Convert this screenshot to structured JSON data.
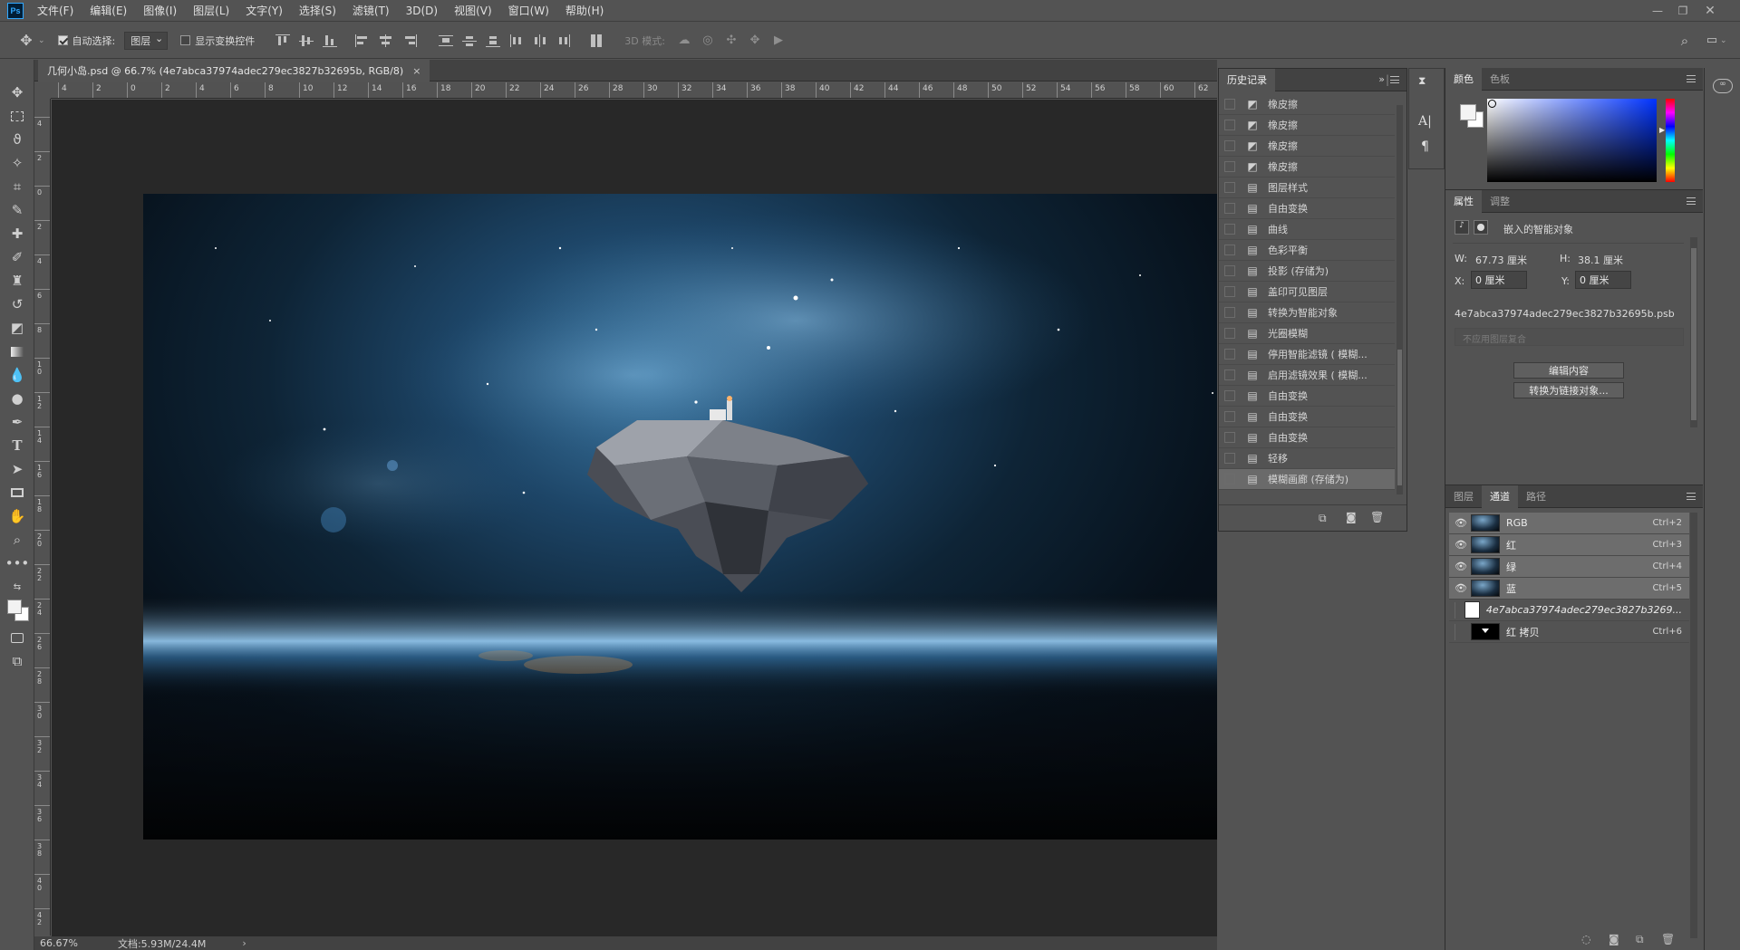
{
  "menu": {
    "items": [
      "文件(F)",
      "编辑(E)",
      "图像(I)",
      "图层(L)",
      "文字(Y)",
      "选择(S)",
      "滤镜(T)",
      "3D(D)",
      "视图(V)",
      "窗口(W)",
      "帮助(H)"
    ]
  },
  "options": {
    "auto_select_label": "自动选择:",
    "auto_select_value": "图层",
    "show_transform_label": "显示变换控件",
    "mode_3d_label": "3D 模式:"
  },
  "document": {
    "tab_title": "几何小岛.psd @ 66.7% (4e7abca37974adec279ec3827b32695b, RGB/8)",
    "close_glyph": "×",
    "zoom": "66.67%",
    "doc_size": "文档:5.93M/24.4M"
  },
  "rulers": {
    "h_labels": [
      "4",
      "2",
      "0",
      "2",
      "4",
      "6",
      "8",
      "10",
      "12",
      "14",
      "16",
      "18",
      "20",
      "22",
      "24",
      "26",
      "28",
      "30",
      "32",
      "34",
      "36",
      "38",
      "40",
      "42",
      "44",
      "46",
      "48",
      "50",
      "52",
      "54",
      "56",
      "58",
      "60",
      "62"
    ],
    "v_labels": [
      "4",
      "2",
      "0",
      "2",
      "4",
      "6",
      "8",
      "1 0",
      "1 2",
      "1 4",
      "1 6",
      "1 8",
      "2 0",
      "2 2",
      "2 4",
      "2 6",
      "2 8",
      "3 0",
      "3 2",
      "3 4",
      "3 6",
      "3 8",
      "4 0",
      "4 2"
    ]
  },
  "history": {
    "tab": "历史记录",
    "items": [
      {
        "label": "橡皮擦",
        "icon": "eraser"
      },
      {
        "label": "橡皮擦",
        "icon": "eraser"
      },
      {
        "label": "橡皮擦",
        "icon": "eraser"
      },
      {
        "label": "橡皮擦",
        "icon": "eraser"
      },
      {
        "label": "图层样式",
        "icon": "doc"
      },
      {
        "label": "自由变换",
        "icon": "doc"
      },
      {
        "label": "曲线",
        "icon": "doc"
      },
      {
        "label": "色彩平衡",
        "icon": "doc"
      },
      {
        "label": "投影 (存储为)",
        "icon": "doc"
      },
      {
        "label": "盖印可见图层",
        "icon": "doc"
      },
      {
        "label": "转换为智能对象",
        "icon": "doc"
      },
      {
        "label": "光圈模糊",
        "icon": "doc"
      },
      {
        "label": "停用智能滤镜 ( 模糊...",
        "icon": "doc"
      },
      {
        "label": "启用滤镜效果 ( 模糊...",
        "icon": "doc"
      },
      {
        "label": "自由变换",
        "icon": "doc"
      },
      {
        "label": "自由变换",
        "icon": "doc"
      },
      {
        "label": "自由变换",
        "icon": "doc"
      },
      {
        "label": "轻移",
        "icon": "doc"
      },
      {
        "label": "模糊画廊 (存储为)",
        "icon": "doc"
      }
    ],
    "selected_index": 18
  },
  "color_panel": {
    "tabs": [
      "颜色",
      "色板"
    ]
  },
  "properties": {
    "tabs": [
      "属性",
      "调整"
    ],
    "kind": "嵌入的智能对象",
    "w_label": "W:",
    "w_value": "67.73 厘米",
    "h_label": "H:",
    "h_value": "38.1 厘米",
    "x_label": "X:",
    "x_value": "0 厘米",
    "y_label": "Y:",
    "y_value": "0 厘米",
    "filename": "4e7abca37974adec279ec3827b32695b.psb",
    "comp_placeholder": "不应用图层复合",
    "edit_btn": "编辑内容",
    "link_btn": "转换为链接对象..."
  },
  "channels": {
    "tabs": [
      "图层",
      "通道",
      "路径"
    ],
    "rows": [
      {
        "name": "RGB",
        "key": "Ctrl+2",
        "visible": true,
        "selected": true,
        "thumb": "space"
      },
      {
        "name": "红",
        "key": "Ctrl+3",
        "visible": true,
        "selected": true,
        "thumb": "space"
      },
      {
        "name": "绿",
        "key": "Ctrl+4",
        "visible": true,
        "selected": true,
        "thumb": "space"
      },
      {
        "name": "蓝",
        "key": "Ctrl+5",
        "visible": true,
        "selected": true,
        "thumb": "space"
      },
      {
        "name": "4e7abca37974adec279ec3827b3269...",
        "key": "",
        "visible": false,
        "selected": false,
        "thumb": "white"
      },
      {
        "name": "红 拷贝",
        "key": "Ctrl+6",
        "visible": false,
        "selected": false,
        "thumb": "mask"
      }
    ]
  },
  "colors": {
    "accent": "#31a8ff",
    "ui_bg": "#535353",
    "canvas_bg": "#282828"
  }
}
